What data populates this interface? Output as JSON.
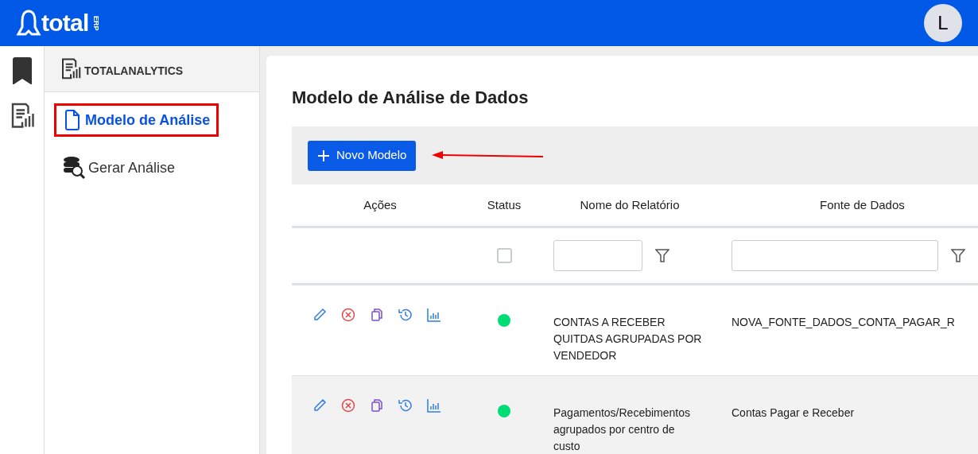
{
  "header": {
    "logo_text": "total",
    "logo_badge": "ERP",
    "avatar": "L"
  },
  "rail": [
    {
      "kind": "bookmark",
      "selected": true
    },
    {
      "kind": "report",
      "selected": false
    }
  ],
  "sidebar": {
    "title": "TOTALANALYTICS",
    "items": [
      {
        "kind": "document",
        "label": "Modelo de Análise",
        "selected": true,
        "highlighted": true
      },
      {
        "kind": "database",
        "label": "Gerar Análise",
        "selected": false,
        "highlighted": false
      }
    ]
  },
  "page": {
    "title": "Modelo de Análise de Dados",
    "new_button": "Novo Modelo",
    "arrow_to_button": true
  },
  "table": {
    "columns": [
      "Ações",
      "Status",
      "Nome do Relatório",
      "Fonte de Dados"
    ],
    "filters": {
      "status_checked": false
    },
    "rows": [
      {
        "color": "#00dd77",
        "name": "CONTAS A RECEBER QUITDAS AGRUPADAS POR VENDEDOR",
        "source": "NOVA_FONTE_DADOS_CONTA_PAGAR_R",
        "selected": false
      },
      {
        "color": "#00dd77",
        "name": "Pagamentos/Recebimentos agrupados por centro de custo",
        "source": "Contas Pagar e Receber",
        "selected": true
      }
    ]
  }
}
